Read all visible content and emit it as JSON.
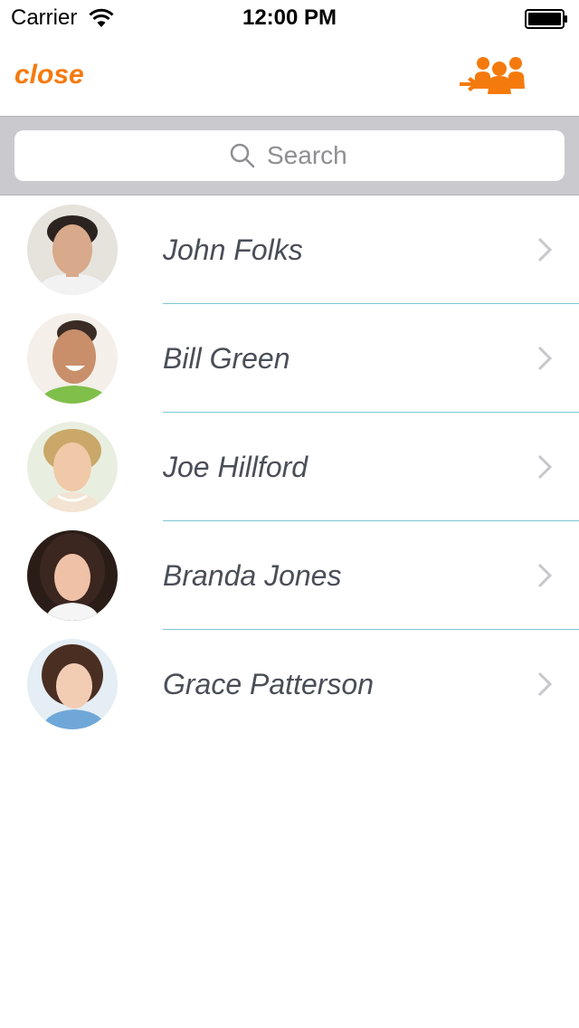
{
  "status_bar": {
    "carrier": "Carrier",
    "time": "12:00 PM"
  },
  "nav": {
    "close_label": "close",
    "group_icon": "group-add-icon"
  },
  "search": {
    "placeholder": "Search",
    "value": ""
  },
  "colors": {
    "accent": "#f57a0d",
    "separator": "#7cc8d2",
    "search_bg": "#c9c9ce",
    "name_text": "#4a4e57"
  },
  "contacts": [
    {
      "name": "John Folks"
    },
    {
      "name": "Bill Green"
    },
    {
      "name": "Joe Hillford"
    },
    {
      "name": "Branda Jones"
    },
    {
      "name": "Grace Patterson"
    }
  ]
}
